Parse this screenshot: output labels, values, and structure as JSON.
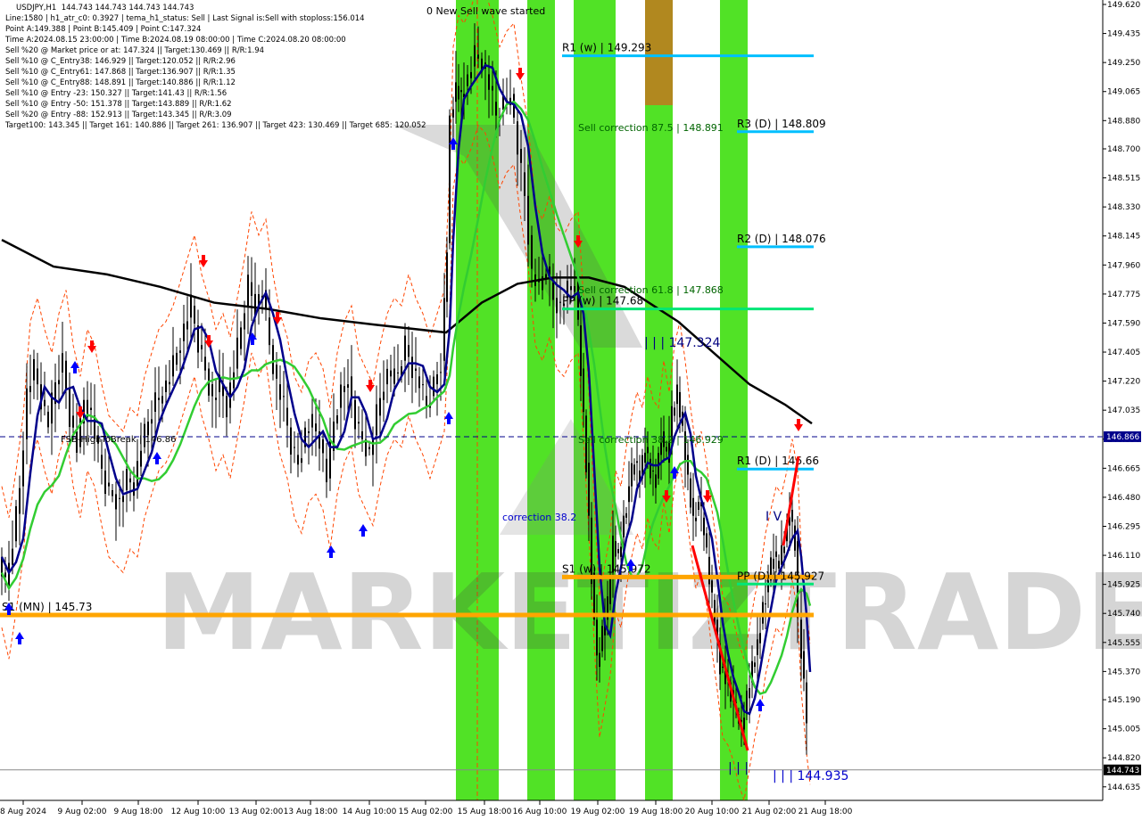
{
  "header": {
    "lines": [
      "USDJPY,H1  144.743 144.743 144.743 144.743",
      "Line:1580 | h1_atr_c0: 0.3927 | tema_h1_status: Sell | Last Signal is:Sell with stoploss:156.014",
      "Point A:149.388 | Point B:145.409 | Point C:147.324",
      "Time A:2024.08.15 23:00:00 | Time B:2024.08.19 08:00:00 | Time C:2024.08.20 08:00:00",
      "Sell %20 @ Market price or at: 147.324 || Target:130.469 || R/R:1.94",
      "Sell %10 @ C_Entry38: 146.929 || Target:120.052 || R/R:2.96",
      "Sell %10 @ C_Entry61: 147.868 || Target:136.907 || R/R:1.35",
      "Sell %10 @ C_Entry88: 148.891 || Target:140.886 || R/R:1.12",
      "Sell %10 @ Entry -23: 150.327 || Target:141.43 || R/R:1.56",
      "Sell %10 @ Entry -50: 151.378 || Target:143.889 || R/R:1.62",
      "Sell %20 @ Entry -88: 152.913 || Target:143.345 || R/R:3.09",
      "Target100: 143.345 || Target 161: 140.886 || Target 261: 136.907 || Target 423: 130.469 || Target 685: 120.052"
    ]
  },
  "watermark": "MARKETIZTRADE",
  "chart_data": {
    "type": "candlestick",
    "symbol": "USDJPY,H1",
    "ylim": [
      144.56,
      149.62
    ],
    "y_ticks": [
      "149.620",
      "149.435",
      "149.250",
      "149.065",
      "148.880",
      "148.700",
      "148.515",
      "148.330",
      "148.145",
      "147.960",
      "147.775",
      "147.590",
      "147.405",
      "147.220",
      "147.035",
      "146.850",
      "146.665",
      "146.480",
      "146.295",
      "146.110",
      "145.925",
      "145.740",
      "145.555",
      "145.370",
      "145.190",
      "145.005",
      "144.820",
      "144.635"
    ],
    "x_ticks": [
      "8 Aug 2024",
      "9 Aug 02:00",
      "9 Aug 18:00",
      "12 Aug 10:00",
      "13 Aug 02:00",
      "13 Aug 18:00",
      "14 Aug 10:00",
      "15 Aug 02:00",
      "15 Aug 18:00",
      "16 Aug 10:00",
      "19 Aug 02:00",
      "19 Aug 18:00",
      "20 Aug 10:00",
      "21 Aug 02:00",
      "21 Aug 18:00"
    ],
    "current_price": "144.743",
    "horizontal_marker": {
      "label": "146.866",
      "value": 146.866
    },
    "levels": [
      {
        "label": "R1 (w) | 149.293",
        "value": 149.293,
        "color": "#00bfff"
      },
      {
        "label": "R3 (D) | 148.809",
        "value": 148.809,
        "color": "#00bfff"
      },
      {
        "label": "R2 (D) | 148.076",
        "value": 148.076,
        "color": "#00bfff"
      },
      {
        "label": "PP (w) | 147.68",
        "value": 147.68,
        "color": "#00e676"
      },
      {
        "label": "R1 (D) | 146.66",
        "value": 146.66,
        "color": "#00bfff"
      },
      {
        "label": "S1 (w) | 145.972",
        "value": 145.972,
        "color": "#ffa500"
      },
      {
        "label": "PP (D) | 145.927",
        "value": 145.927,
        "color": "#00e676"
      },
      {
        "label": "S1 (MN) | 145.73",
        "value": 145.73,
        "color": "#ffa500"
      }
    ],
    "annotations": [
      {
        "text": "0 New Sell wave started",
        "color": "#000000"
      },
      {
        "text": "Sell correction 87.5 | 148.891",
        "color": "#006400"
      },
      {
        "text": "Sell correction 61.8 | 147.868",
        "color": "#006400"
      },
      {
        "text": "Sell correction 38.2 | 146.929",
        "color": "#006400"
      },
      {
        "text": "correction 38.2",
        "color": "#0000cd"
      },
      {
        "text": "| | | 147.324",
        "color": "#000080"
      },
      {
        "text": "| | | 144.935",
        "color": "#0000cd"
      },
      {
        "text": "| | |",
        "color": "#000080"
      },
      {
        "text": "I V",
        "color": "#000080"
      },
      {
        "text": "FSB-HighToBreak | 146.86",
        "color": "#000000"
      }
    ],
    "series": [
      {
        "name": "price",
        "color": "#000000"
      },
      {
        "name": "ma-200",
        "color": "#000000"
      },
      {
        "name": "ma-fast",
        "color": "#00008b"
      },
      {
        "name": "ma-mid",
        "color": "#32cd32"
      }
    ],
    "colors": {
      "green_band": "#33dd00",
      "orange_band": "#d2691e",
      "sell_arrow": "#ff0000",
      "buy_arrow": "#0000ff",
      "channel": "#ff4500"
    }
  }
}
